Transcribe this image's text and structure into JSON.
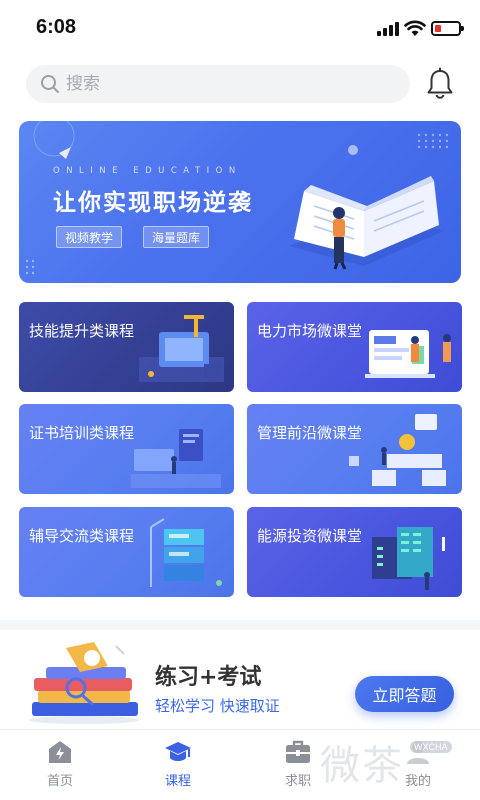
{
  "status_bar": {
    "time": "6:08",
    "battery_level": 0.25,
    "battery_color": "#e5322d"
  },
  "search": {
    "placeholder": "搜索",
    "icon": "search-icon"
  },
  "header": {
    "notification_icon": "bell-icon"
  },
  "banner": {
    "eyebrow": "ONLINE EDUCATION",
    "headline": "让你实现职场逆袭",
    "tags": [
      "视频教学",
      "海量题库"
    ]
  },
  "courses": [
    {
      "label": "技能提升类课程"
    },
    {
      "label": "电力市场微课堂"
    },
    {
      "label": "证书培训类课程"
    },
    {
      "label": "管理前沿微课堂"
    },
    {
      "label": "辅导交流类课程"
    },
    {
      "label": "能源投资微课堂"
    }
  ],
  "practice": {
    "title": "练习+考试",
    "subtitle": "轻松学习  快速取证",
    "button": "立即答题"
  },
  "tabs": [
    {
      "label": "首页",
      "icon": "home-icon",
      "active": false
    },
    {
      "label": "课程",
      "icon": "graduation-cap-icon",
      "active": true
    },
    {
      "label": "求职",
      "icon": "briefcase-icon",
      "active": false
    },
    {
      "label": "我的",
      "icon": "user-icon",
      "active": false
    }
  ],
  "watermark": {
    "text": "微茶",
    "badge": "WXCHA"
  },
  "colors": {
    "accent": "#3a62e4",
    "inactive": "#8a8f98"
  }
}
